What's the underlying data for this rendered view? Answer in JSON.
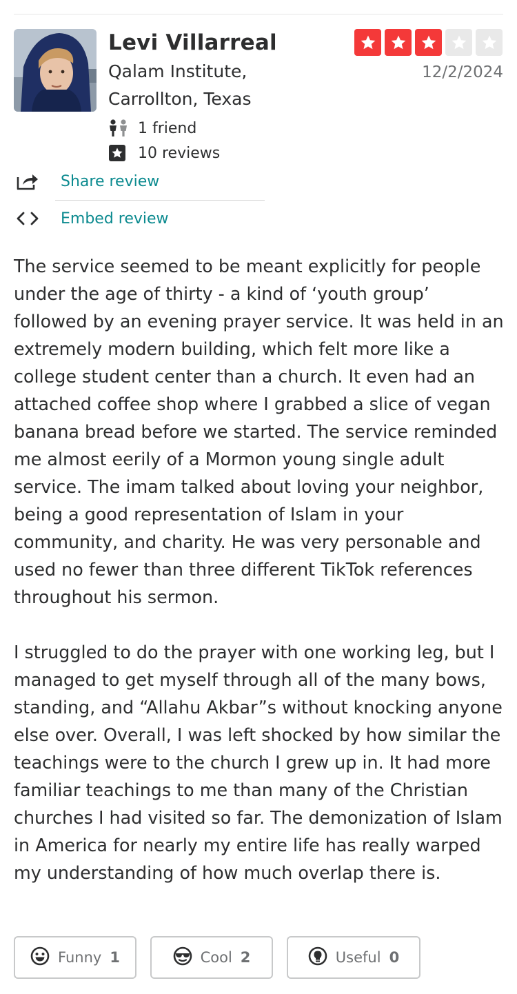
{
  "user": {
    "name": "Levi Villarreal",
    "location_line1": "Qalam Institute,",
    "location_line2": "Carrollton, Texas",
    "friends": "1 friend",
    "reviews": "10 reviews",
    "avatar_icon": "user-photo"
  },
  "rating": {
    "stars": 3,
    "max": 5,
    "date": "12/2/2024",
    "on_color": "#f43939",
    "off_color": "#e9e9e9"
  },
  "actions": {
    "share_label": "Share review",
    "embed_label": "Embed review",
    "link_color": "#0b8a8f"
  },
  "review": {
    "paragraph1": "The service seemed to be meant explicitly for people under the age of thirty - a kind of ‘youth group’ followed by an evening prayer service. It was held in an extremely modern building, which felt more like a college student center than a church. It even had an attached coffee shop where I grabbed a slice of vegan banana bread before we started. The service reminded me almost eerily of a Mormon young single adult service. The imam talked about loving your neighbor, being a good representation of Islam in your community, and charity. He was very personable and used no fewer than three different TikTok references throughout his sermon.",
    "paragraph2": "I struggled to do the prayer with one working leg, but I managed to get myself through all of the many bows, standing, and “Allahu Akbar”s without knocking anyone else over. Overall, I was left shocked by how similar the teachings were to the church I grew up in. It had more familiar teachings to me than many of the Christian churches I had visited so far. The demonization of Islam in America for nearly my entire life has really warped my understanding of how much overlap there is."
  },
  "votes": {
    "funny_label": "Funny",
    "funny_count": "1",
    "cool_label": "Cool",
    "cool_count": "2",
    "useful_label": "Useful",
    "useful_count": "0"
  }
}
